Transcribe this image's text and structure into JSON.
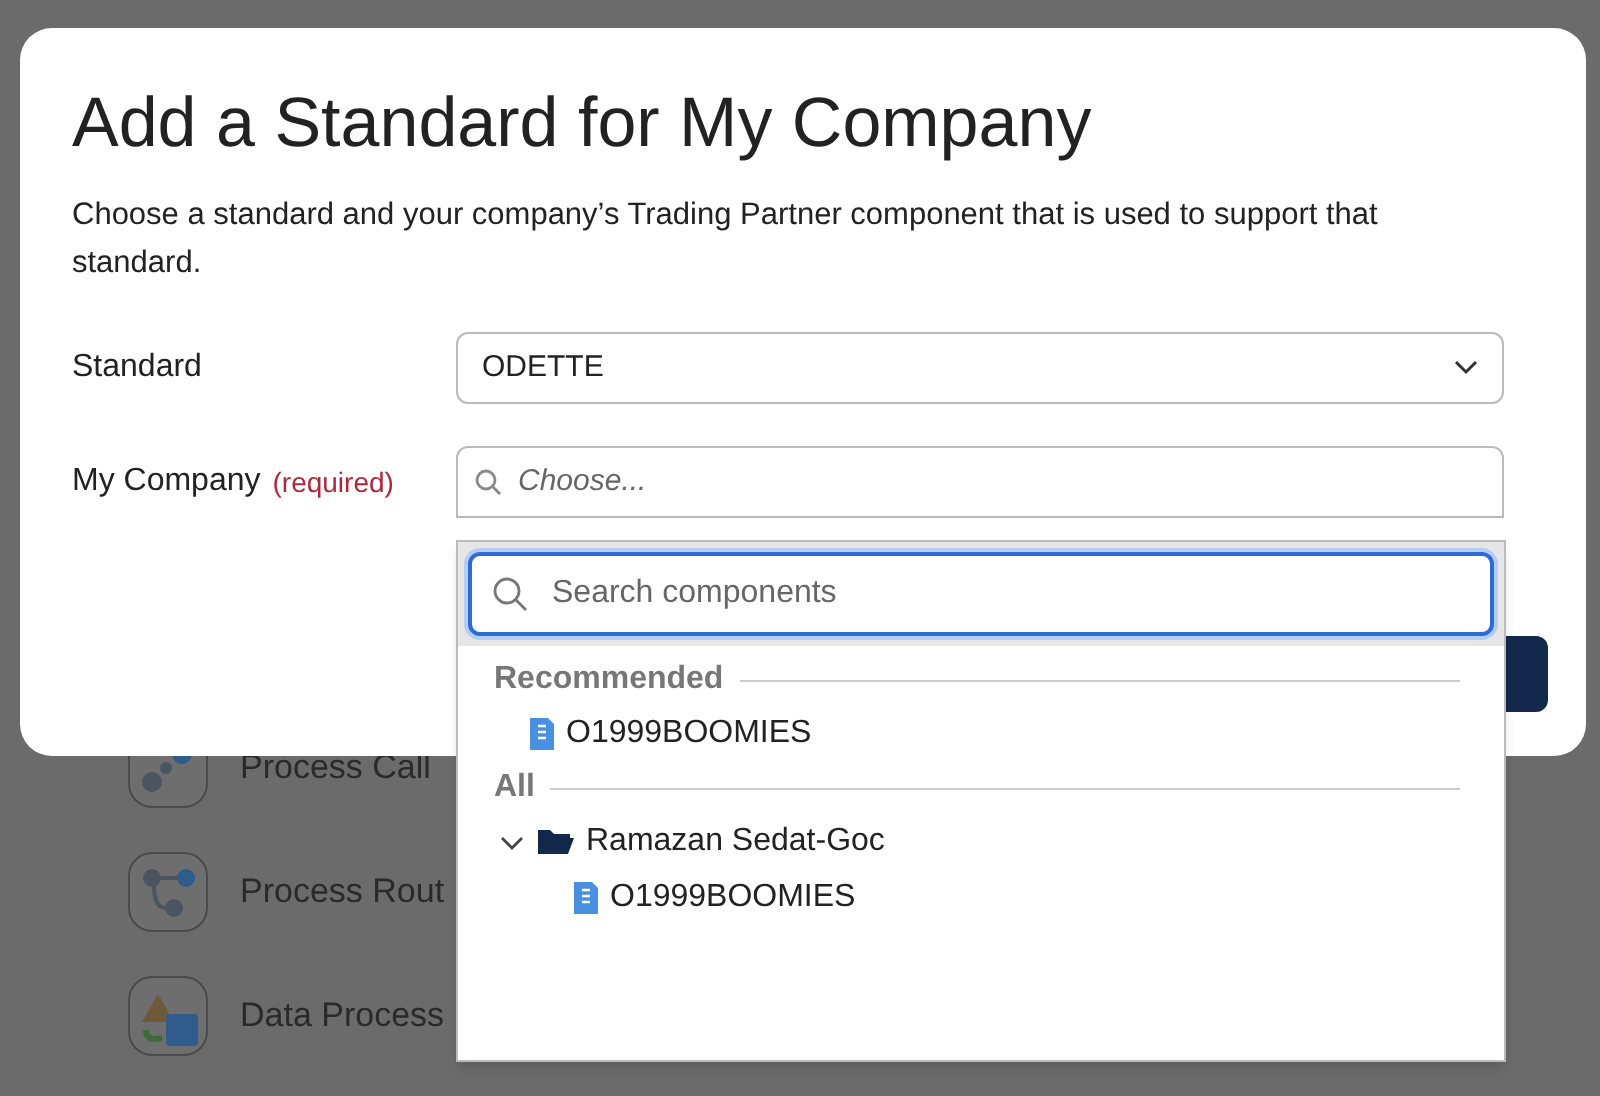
{
  "background": {
    "palette_items": [
      {
        "label": "Process Call",
        "kind": "gears"
      },
      {
        "label": "Process Rout",
        "kind": "route"
      },
      {
        "label": "Data Process",
        "kind": "shapes"
      }
    ]
  },
  "dialog": {
    "title": "Add a Standard for My Company",
    "description": "Choose a standard and your company’s Trading Partner component that is used to support that standard.",
    "fields": [
      {
        "label": "Standard",
        "kind": "select",
        "value": "ODETTE"
      },
      {
        "label": "My Company",
        "required_note": "(required)",
        "kind": "combobox",
        "placeholder": "Choose...",
        "expanded": true
      }
    ]
  },
  "dropdown": {
    "search": {
      "placeholder": "Search components"
    },
    "groups": [
      {
        "heading": "Recommended",
        "items": [
          {
            "label": "O1999BOOMIES",
            "kind": "component"
          }
        ]
      },
      {
        "heading": "All",
        "items": [
          {
            "label": "Ramazan Sedat-Goc",
            "kind": "folder",
            "expanded": true,
            "children": [
              {
                "label": "O1999BOOMIES",
                "kind": "component"
              }
            ]
          }
        ]
      }
    ]
  }
}
